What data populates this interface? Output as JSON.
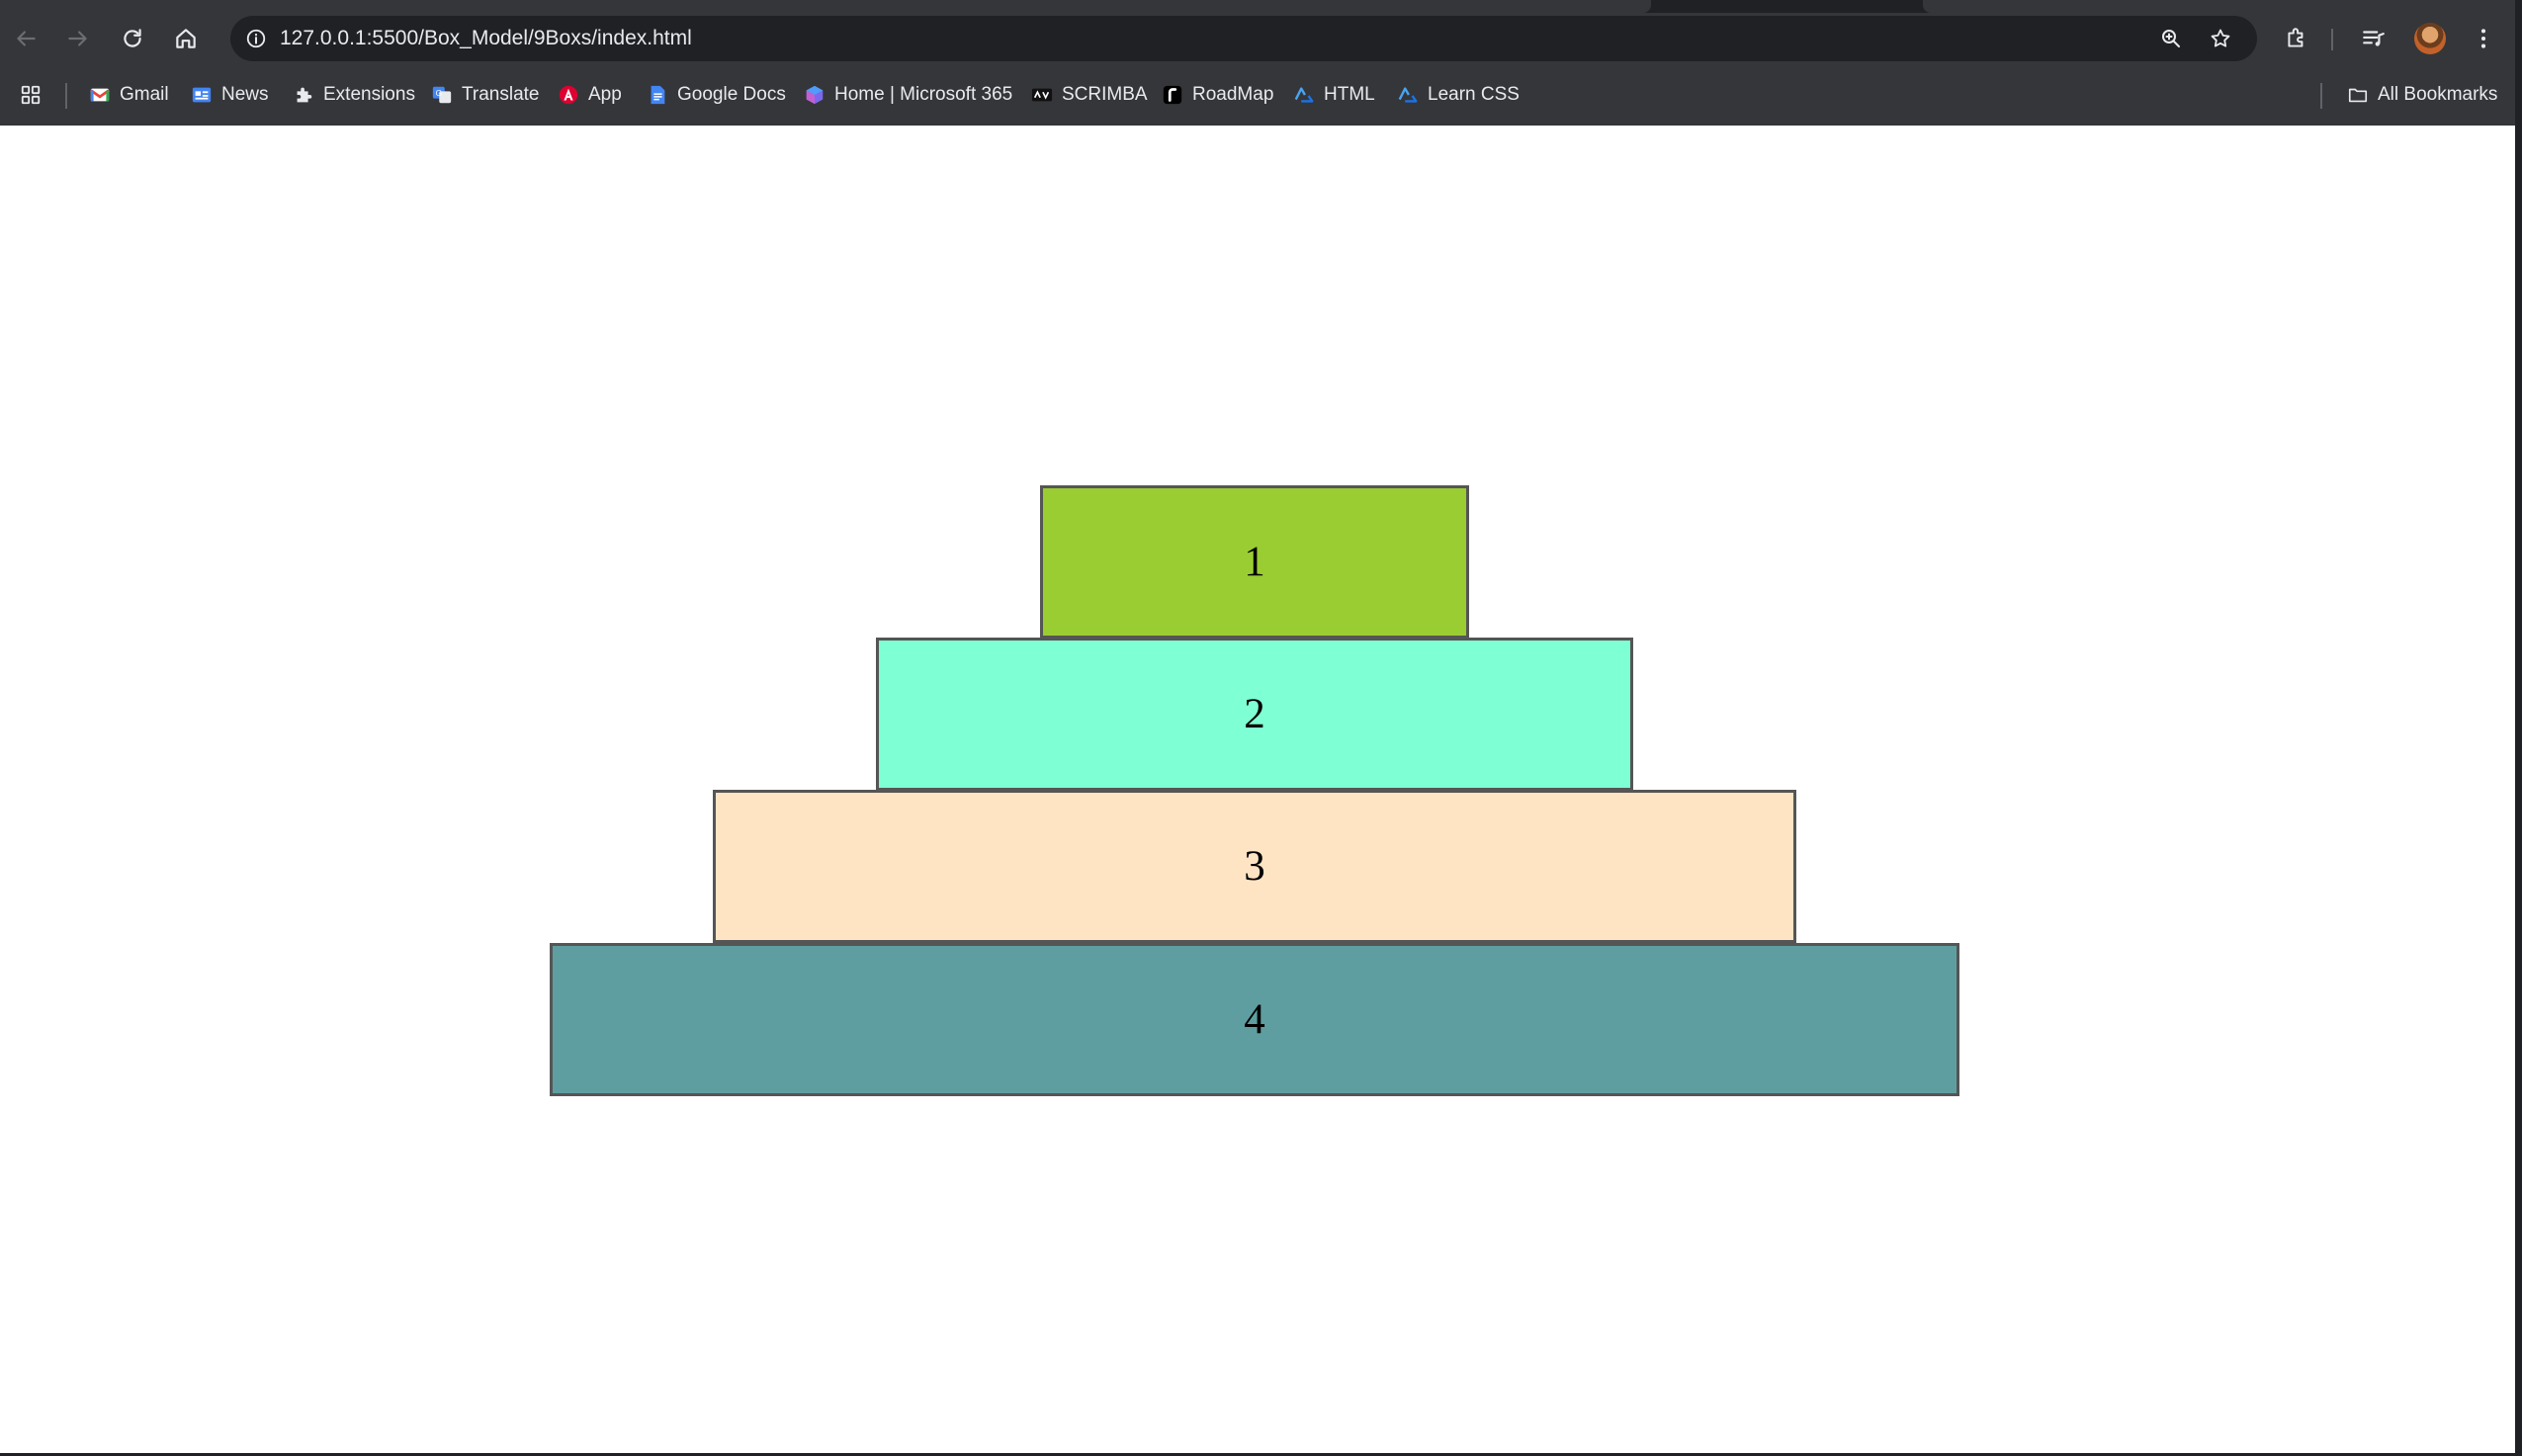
{
  "browser": {
    "url": "127.0.0.1:5500/Box_Model/9Boxs/index.html"
  },
  "bookmarks": [
    {
      "label": "Gmail",
      "icon": "gmail-icon"
    },
    {
      "label": "News",
      "icon": "news-icon"
    },
    {
      "label": "Extensions",
      "icon": "puzzle-icon"
    },
    {
      "label": "Translate",
      "icon": "translate-icon"
    },
    {
      "label": "App",
      "icon": "angular-icon"
    },
    {
      "label": "Google Docs",
      "icon": "docs-icon"
    },
    {
      "label": "Home | Microsoft 365",
      "icon": "microsoft365-icon"
    },
    {
      "label": "SCRIMBA",
      "icon": "scrimba-icon"
    },
    {
      "label": "RoadMap",
      "icon": "roadmap-icon"
    },
    {
      "label": "HTML",
      "icon": "html-course-icon"
    },
    {
      "label": "Learn CSS",
      "icon": "learn-css-icon"
    }
  ],
  "all_bookmarks": {
    "label": "All Bookmarks",
    "icon": "folder-icon"
  },
  "page": {
    "boxes": [
      {
        "label": "1",
        "color": "#9ACD32"
      },
      {
        "label": "2",
        "color": "#7FFFD4"
      },
      {
        "label": "3",
        "color": "#FFE4C4"
      },
      {
        "label": "4",
        "color": "#5F9EA0"
      }
    ]
  }
}
